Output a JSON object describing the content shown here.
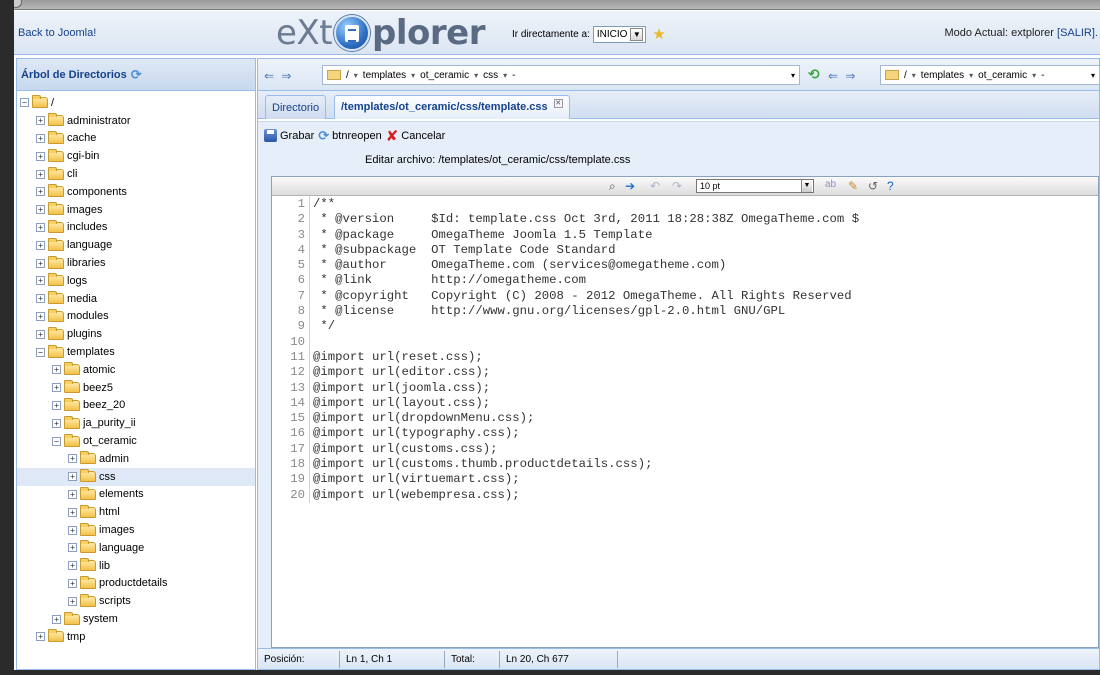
{
  "header": {
    "back_link": "Back to Joomla!",
    "logo_left": "eXt",
    "logo_right": "plorer",
    "goto_label": "Ir directamente a:",
    "goto_value": "INICIO",
    "mode_label": "Modo Actual: extplorer",
    "salir": "[SALIR]."
  },
  "left": {
    "title": "Árbol de Directorios",
    "tree": [
      {
        "label": "/",
        "depth": 0,
        "expanded": true
      },
      {
        "label": "administrator",
        "depth": 1
      },
      {
        "label": "cache",
        "depth": 1
      },
      {
        "label": "cgi-bin",
        "depth": 1
      },
      {
        "label": "cli",
        "depth": 1
      },
      {
        "label": "components",
        "depth": 1
      },
      {
        "label": "images",
        "depth": 1
      },
      {
        "label": "includes",
        "depth": 1
      },
      {
        "label": "language",
        "depth": 1
      },
      {
        "label": "libraries",
        "depth": 1
      },
      {
        "label": "logs",
        "depth": 1
      },
      {
        "label": "media",
        "depth": 1
      },
      {
        "label": "modules",
        "depth": 1
      },
      {
        "label": "plugins",
        "depth": 1
      },
      {
        "label": "templates",
        "depth": 1,
        "expanded": true
      },
      {
        "label": "atomic",
        "depth": 2
      },
      {
        "label": "beez5",
        "depth": 2
      },
      {
        "label": "beez_20",
        "depth": 2
      },
      {
        "label": "ja_purity_ii",
        "depth": 2
      },
      {
        "label": "ot_ceramic",
        "depth": 2,
        "expanded": true
      },
      {
        "label": "admin",
        "depth": 3
      },
      {
        "label": "css",
        "depth": 3,
        "selected": true
      },
      {
        "label": "elements",
        "depth": 3
      },
      {
        "label": "html",
        "depth": 3
      },
      {
        "label": "images",
        "depth": 3
      },
      {
        "label": "language",
        "depth": 3
      },
      {
        "label": "lib",
        "depth": 3
      },
      {
        "label": "productdetails",
        "depth": 3
      },
      {
        "label": "scripts",
        "depth": 3
      },
      {
        "label": "system",
        "depth": 2
      },
      {
        "label": "tmp",
        "depth": 1
      }
    ]
  },
  "pathbar": {
    "left": [
      "/",
      "templates",
      "ot_ceramic",
      "css",
      "-"
    ],
    "right": [
      "/",
      "templates",
      "ot_ceramic",
      "-"
    ]
  },
  "tabs": {
    "directorio": "Directorio",
    "file": "/templates/ot_ceramic/css/template.css"
  },
  "actions": {
    "save": "Grabar",
    "reopen": "btnreopen",
    "cancel": "Cancelar"
  },
  "edit_label": "Editar archivo: /templates/ot_ceramic/css/template.css",
  "editor": {
    "font_size": "10 pt",
    "lines": [
      "/**",
      " * @version     $Id: template.css Oct 3rd, 2011 18:28:38Z OmegaTheme.com $",
      " * @package     OmegaTheme Joomla 1.5 Template",
      " * @subpackage  OT Template Code Standard",
      " * @author      OmegaTheme.com (services@omegatheme.com)",
      " * @link        http://omegatheme.com",
      " * @copyright   Copyright (C) 2008 - 2012 OmegaTheme. All Rights Reserved",
      " * @license     http://www.gnu.org/licenses/gpl-2.0.html GNU/GPL",
      " */",
      "",
      "@import url(reset.css);",
      "@import url(editor.css);",
      "@import url(joomla.css);",
      "@import url(layout.css);",
      "@import url(dropdownMenu.css);",
      "@import url(typography.css);",
      "@import url(customs.css);",
      "@import url(customs.thumb.productdetails.css);",
      "@import url(virtuemart.css);",
      "@import url(webempresa.css);"
    ]
  },
  "status": {
    "pos_label": "Posición:",
    "pos_value": "Ln 1, Ch 1",
    "total_label": "Total:",
    "total_value": "Ln 20, Ch 677"
  }
}
